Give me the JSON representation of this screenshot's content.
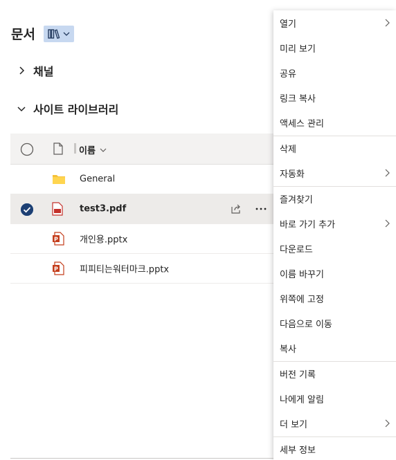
{
  "page": {
    "title": "문서"
  },
  "nav": {
    "channels_label": "채널",
    "site_libraries_label": "사이트 라이브러리"
  },
  "list": {
    "header_name": "이름",
    "rows": [
      {
        "name": "General",
        "type": "folder",
        "selected": false
      },
      {
        "name": "test3.pdf",
        "type": "pdf",
        "selected": true
      },
      {
        "name": "개인용.pptx",
        "type": "pptx",
        "selected": false
      },
      {
        "name": "피피티는워터마크.pptx",
        "type": "pptx",
        "selected": false
      }
    ]
  },
  "context_menu": {
    "items": [
      {
        "label": "열기",
        "submenu": true
      },
      {
        "label": "미리 보기",
        "submenu": false
      },
      {
        "label": "공유",
        "submenu": false
      },
      {
        "label": "링크 복사",
        "submenu": false
      },
      {
        "label": "액세스 관리",
        "submenu": false
      },
      {
        "label": "삭제",
        "submenu": false
      },
      {
        "label": "자동화",
        "submenu": true
      },
      {
        "label": "즐겨찾기",
        "submenu": false
      },
      {
        "label": "바로 가기 추가",
        "submenu": true
      },
      {
        "label": "다운로드",
        "submenu": false
      },
      {
        "label": "이름 바꾸기",
        "submenu": false
      },
      {
        "label": "위쪽에 고정",
        "submenu": false
      },
      {
        "label": "다음으로 이동",
        "submenu": false
      },
      {
        "label": "복사",
        "submenu": false
      },
      {
        "label": "버전 기록",
        "submenu": false
      },
      {
        "label": "나에게 알림",
        "submenu": false
      },
      {
        "label": "더 보기",
        "submenu": true
      },
      {
        "label": "세부 정보",
        "submenu": false
      }
    ]
  },
  "colors": {
    "accent": "#0f6cbd",
    "selected_row_bg": "#edebe9",
    "library_button_bg": "#c7d8f0",
    "folder": "#f5c139",
    "pdf_red": "#c4312b",
    "pptx_orange": "#c43e1c"
  }
}
